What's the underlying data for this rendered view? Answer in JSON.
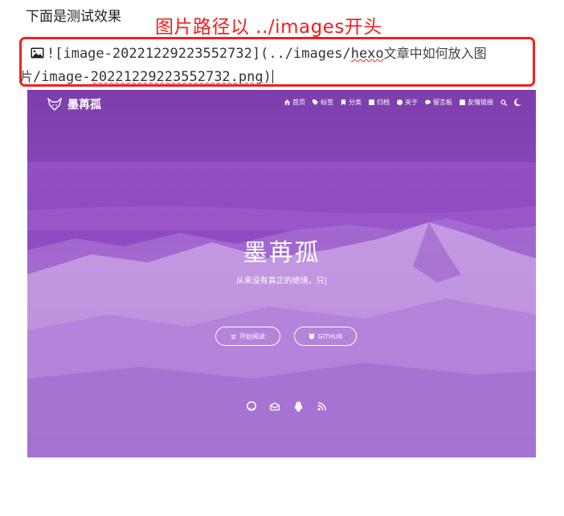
{
  "caption": "下面是测试效果",
  "note": "图片路径以 ../images开头",
  "markdown": {
    "line1_prefix": "![image-20221229223552732](../images/",
    "line1_word": "hexo",
    "line1_cjk": "文章中如何放入图",
    "line2_cjk": "片",
    "line2_prefix": "/image-",
    "line2_word": "20221229223552732.png",
    "line2_suffix": ")"
  },
  "blog": {
    "logo_text": "墨苒孤",
    "nav": [
      {
        "icon": "home-icon",
        "label": "首页"
      },
      {
        "icon": "tag-icon",
        "label": "标签"
      },
      {
        "icon": "bookmark-icon",
        "label": "分类"
      },
      {
        "icon": "archive-icon",
        "label": "归档"
      },
      {
        "icon": "user-icon",
        "label": "关于"
      },
      {
        "icon": "comments-icon",
        "label": "留言板"
      },
      {
        "icon": "link-icon",
        "label": "友情链接"
      }
    ],
    "title": "墨苒孤",
    "subtitle": "从来没有真正的绝境，只|",
    "read_button": "开始阅读",
    "github_button": "GITHUB",
    "socials": [
      "github-icon",
      "mail-icon",
      "qq-icon",
      "rss-icon"
    ],
    "colors": {
      "overlay": "#9350c4"
    }
  }
}
